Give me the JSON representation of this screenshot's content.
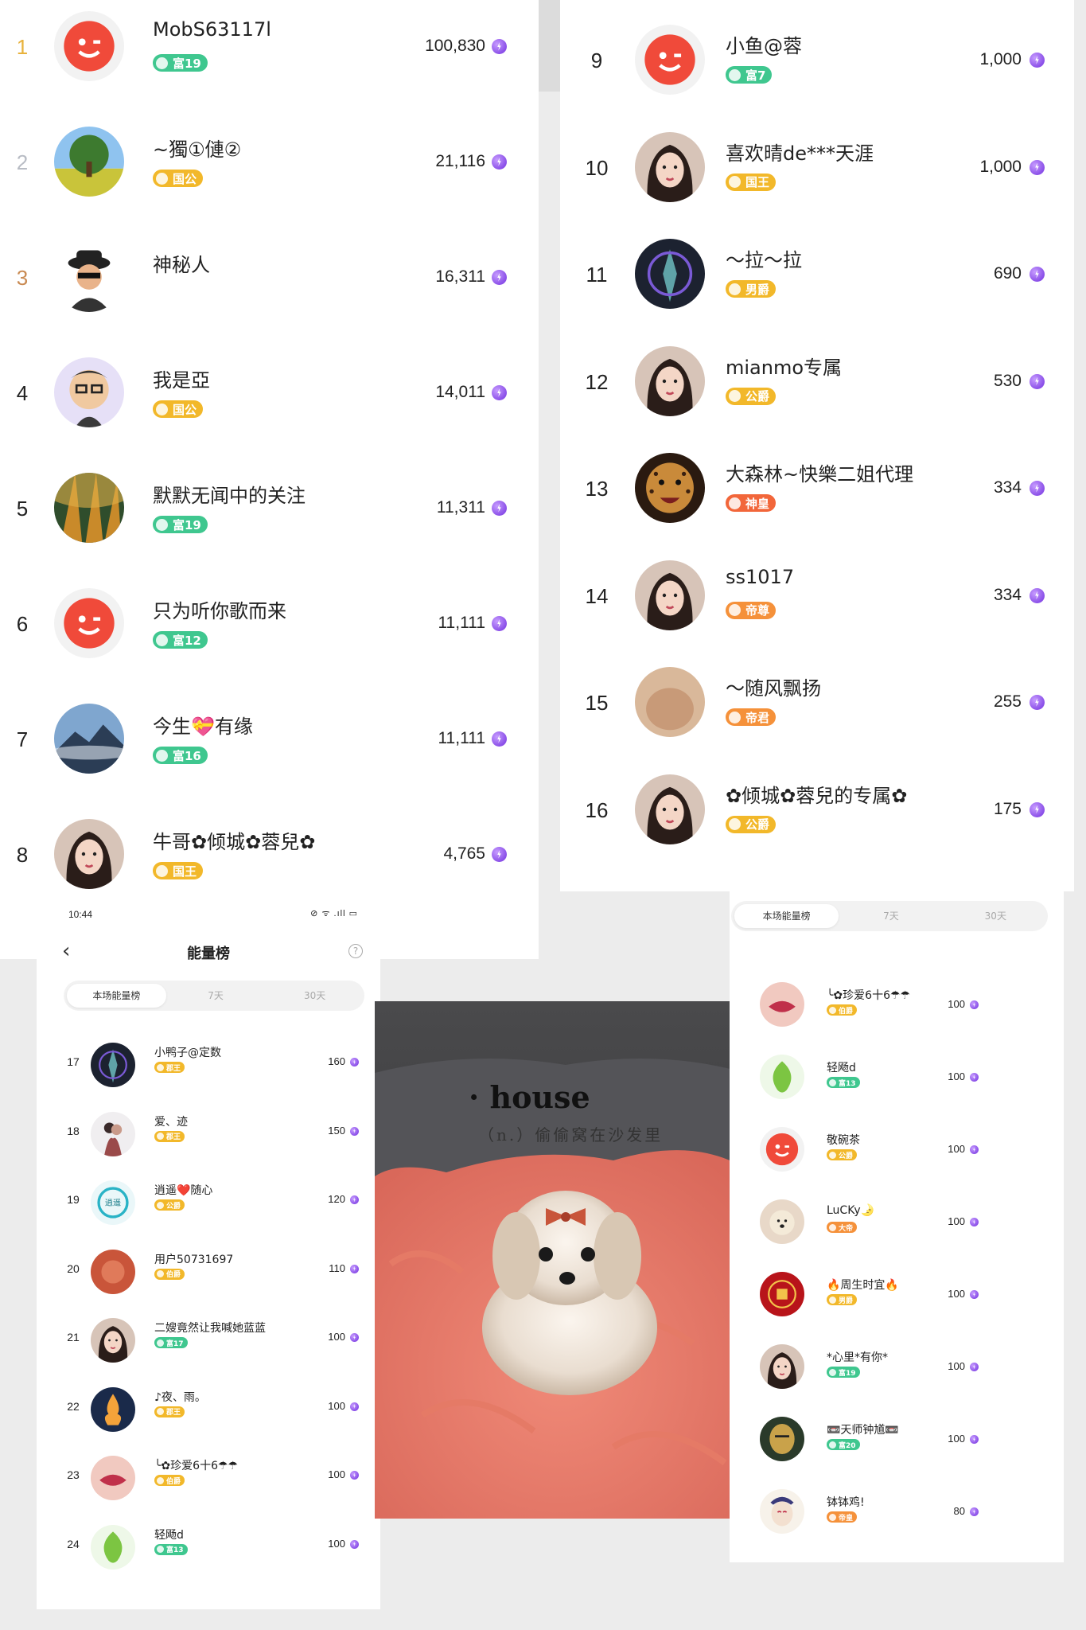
{
  "top_left": [
    {
      "rank": "1",
      "name": "MobS63117l",
      "badge": "富19",
      "score": "100,830",
      "badge_color": "#3fc78f",
      "avatar": "smile"
    },
    {
      "rank": "2",
      "name": "~獨①僆②",
      "badge": "国公",
      "score": "21,116",
      "badge_color": "#f2b82a",
      "avatar": "tree"
    },
    {
      "rank": "3",
      "name": "神秘人",
      "badge": "",
      "score": "16,311",
      "badge_color": "",
      "avatar": "spy"
    },
    {
      "rank": "4",
      "name": "我是亞",
      "badge": "国公",
      "score": "14,011",
      "badge_color": "#f2b82a",
      "avatar": "cartoon"
    },
    {
      "rank": "5",
      "name": "默默无闻中的关注",
      "badge": "富19",
      "score": "11,311",
      "badge_color": "#3fc78f",
      "avatar": "forest"
    },
    {
      "rank": "6",
      "name": "只为听你歌而来",
      "badge": "富12",
      "score": "11,111",
      "badge_color": "#3fc78f",
      "avatar": "smile"
    },
    {
      "rank": "7",
      "name": "今生💝有缘",
      "badge": "富16",
      "score": "11,111",
      "badge_color": "#3fc78f",
      "avatar": "mountain"
    },
    {
      "rank": "8",
      "name": "牛哥✿倾城✿蓉兒✿",
      "badge": "国王",
      "score": "4,765",
      "badge_color": "#f2b82a",
      "avatar": "girl"
    }
  ],
  "top_right": [
    {
      "rank": "9",
      "name": "小鱼@蓉",
      "badge": "富7",
      "score": "1,000",
      "badge_color": "#3fc78f",
      "avatar": "smile"
    },
    {
      "rank": "10",
      "name": "喜欢晴de***天涯",
      "badge": "国王",
      "score": "1,000",
      "badge_color": "#f2b82a",
      "avatar": "girl"
    },
    {
      "rank": "11",
      "name": "～拉～拉",
      "badge": "男爵",
      "score": "690",
      "badge_color": "#f2b82a",
      "avatar": "dark"
    },
    {
      "rank": "12",
      "name": "mianmo专属",
      "badge": "公爵",
      "score": "530",
      "badge_color": "#f2b82a",
      "avatar": "girl"
    },
    {
      "rank": "13",
      "name": "大森林~快樂二姐代理",
      "badge": "神皇",
      "score": "334",
      "badge_color": "#f2663a",
      "avatar": "leopard"
    },
    {
      "rank": "14",
      "name": "ss1017",
      "badge": "帝尊",
      "score": "334",
      "badge_color": "#f5913a",
      "avatar": "girl"
    },
    {
      "rank": "15",
      "name": "～随风飘扬",
      "badge": "帝君",
      "score": "255",
      "badge_color": "#f5913a",
      "avatar": "blur"
    },
    {
      "rank": "16",
      "name": "✿倾城✿蓉兒的专属✿",
      "badge": "公爵",
      "score": "175",
      "badge_color": "#f2b82a",
      "avatar": "girl"
    }
  ],
  "phone": {
    "status_time": "10:44",
    "status_icons": "⊘ ᯤ .ıll ▭",
    "title": "能量榜",
    "back": "‹",
    "help": "?",
    "tabs": [
      "本场能量榜",
      "7天",
      "30天"
    ]
  },
  "bottom_left": [
    {
      "rank": "17",
      "name": "小鸭子@定数",
      "badge": "郡王",
      "score": "160",
      "badge_color": "#f2b82a",
      "avatar": "dark"
    },
    {
      "rank": "18",
      "name": "爱、迹",
      "badge": "郡王",
      "score": "150",
      "badge_color": "#f2b82a",
      "avatar": "couple"
    },
    {
      "rank": "19",
      "name": "逍遥❤️随心",
      "badge": "公爵",
      "score": "120",
      "badge_color": "#f2b82a",
      "avatar": "text"
    },
    {
      "rank": "20",
      "name": "用户50731697",
      "badge": "伯爵",
      "score": "110",
      "badge_color": "#f2b82a",
      "avatar": "red"
    },
    {
      "rank": "21",
      "name": "二嫂竟然让我喊她蓝蓝",
      "badge": "富17",
      "score": "100",
      "badge_color": "#3fc78f",
      "avatar": "girl"
    },
    {
      "rank": "22",
      "name": "♪夜、雨。",
      "badge": "郡王",
      "score": "100",
      "badge_color": "#f2b82a",
      "avatar": "fire"
    },
    {
      "rank": "23",
      "name": "╰✿珍爱6十6☂☂",
      "badge": "伯爵",
      "score": "100",
      "badge_color": "#f2b82a",
      "avatar": "lips"
    },
    {
      "rank": "24",
      "name": "轻飏d",
      "badge": "富13",
      "score": "100",
      "badge_color": "#3fc78f",
      "avatar": "leaf"
    }
  ],
  "side_tabs": [
    "本场能量榜",
    "7天",
    "30天"
  ],
  "bottom_right": [
    {
      "name": "╰✿珍爱6十6☂☂",
      "badge": "伯爵",
      "score": "100",
      "badge_color": "#f2b82a",
      "avatar": "lips"
    },
    {
      "name": "轻飏d",
      "badge": "富13",
      "score": "100",
      "badge_color": "#3fc78f",
      "avatar": "leaf"
    },
    {
      "name": "敬碗茶",
      "badge": "公爵",
      "score": "100",
      "badge_color": "#f2b82a",
      "avatar": "smile"
    },
    {
      "name": "LuCKy🌛",
      "badge": "大帝",
      "score": "100",
      "badge_color": "#f5913a",
      "avatar": "dog"
    },
    {
      "name": "🔥周生时宜🔥",
      "badge": "男爵",
      "score": "100",
      "badge_color": "#f2b82a",
      "avatar": "seal"
    },
    {
      "name": "*心里*有你*",
      "badge": "富19",
      "score": "100",
      "badge_color": "#3fc78f",
      "avatar": "girl"
    },
    {
      "name": "📼天师钟馗📼",
      "badge": "富20",
      "score": "100",
      "badge_color": "#3fc78f",
      "avatar": "mask"
    },
    {
      "name": "钵钵鸡!",
      "badge": "帝皇",
      "score": "80",
      "badge_color": "#f5913a",
      "avatar": "opera"
    }
  ],
  "photo": {
    "title": "· house",
    "subtitle": "（n.）偷偷窝在沙发里"
  }
}
